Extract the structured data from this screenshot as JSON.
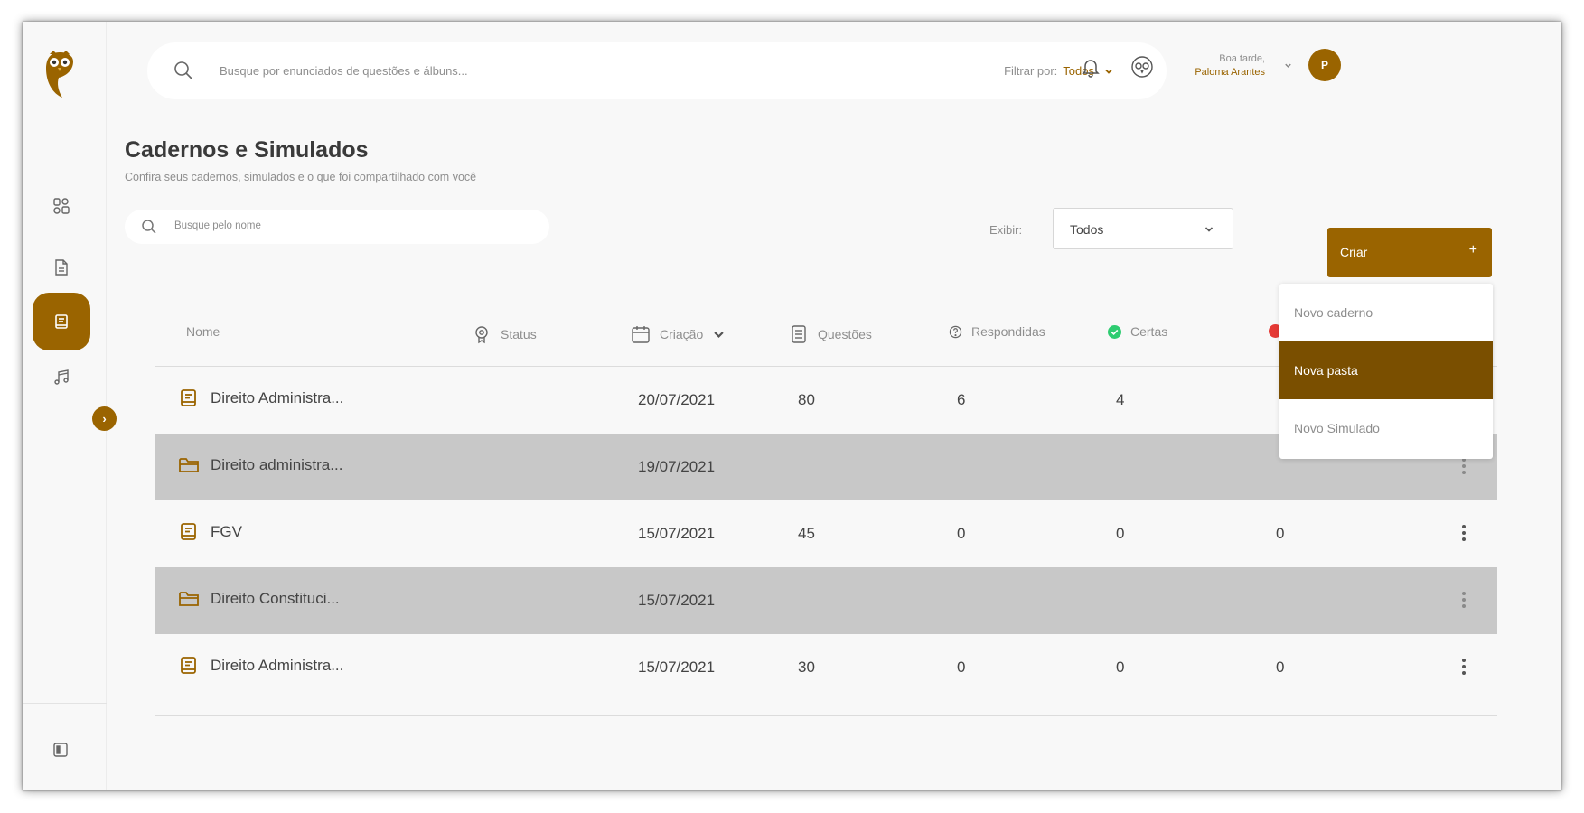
{
  "topbar": {
    "search_placeholder": "Busque por enunciados de questões e álbuns...",
    "filter_label": "Filtrar por:",
    "filter_value": "Todos",
    "greeting": "Boa tarde,",
    "user_name": "Paloma Arantes",
    "avatar_initial": "P"
  },
  "page": {
    "title": "Cadernos e Simulados",
    "subtitle": "Confira seus cadernos, simulados e o que foi compartilhado com você",
    "name_search_placeholder": "Busque pelo nome",
    "exibir_label": "Exibir:",
    "exibir_value": "Todos",
    "create_label": "Criar",
    "create_plus": "+"
  },
  "table": {
    "headers": {
      "name": "Nome",
      "status": "Status",
      "created": "Criação",
      "questions": "Questões",
      "answered": "Respondidas",
      "correct": "Certas"
    },
    "rows": [
      {
        "type": "caderno",
        "name": "Direito Administra...",
        "created": "20/07/2021",
        "questions": "80",
        "answered": "6",
        "correct": "4",
        "wrong": ""
      },
      {
        "type": "pasta",
        "name": "Direito administra...",
        "created": "19/07/2021",
        "questions": "",
        "answered": "",
        "correct": "",
        "wrong": ""
      },
      {
        "type": "caderno",
        "name": "FGV",
        "created": "15/07/2021",
        "questions": "45",
        "answered": "0",
        "correct": "0",
        "wrong": "0"
      },
      {
        "type": "pasta",
        "name": "Direito Constituci...",
        "created": "15/07/2021",
        "questions": "",
        "answered": "",
        "correct": "",
        "wrong": ""
      },
      {
        "type": "caderno",
        "name": "Direito Administra...",
        "created": "15/07/2021",
        "questions": "30",
        "answered": "0",
        "correct": "0",
        "wrong": "0"
      }
    ]
  },
  "dropdown": {
    "items": [
      "Novo caderno",
      "Nova pasta",
      "Novo Simulado"
    ],
    "selected": "Nova pasta"
  },
  "colors": {
    "brand": "#9a6400",
    "brand_dark": "#7a4f00",
    "success": "#2ecc71",
    "danger": "#e53935",
    "folder_row": "#c8c8c8"
  },
  "icons": {
    "sidebar": [
      "dashboard-icon",
      "document-icon",
      "notebook-icon",
      "music-icon"
    ],
    "bottom": "panel-icon"
  }
}
